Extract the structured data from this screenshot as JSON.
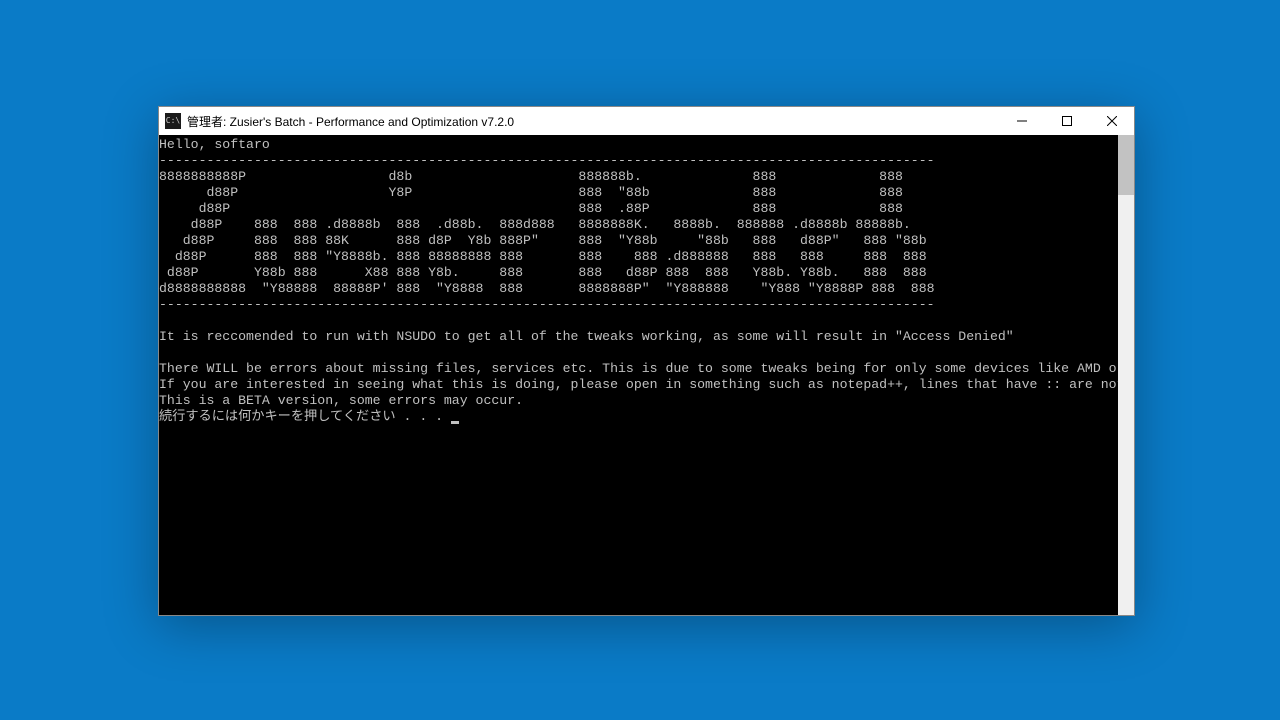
{
  "window": {
    "title": "管理者: Zusier's Batch - Performance and Optimization v7.2.0",
    "icon_label": "C:\\"
  },
  "terminal": {
    "greeting": "Hello, softaro",
    "divider": "--------------------------------------------------------------------------------------------------",
    "ascii_art": [
      "8888888888P                  d8b                     888888b.              888             888",
      "      d88P                   Y8P                     888  \"88b             888             888",
      "     d88P                                            888  .88P             888             888",
      "    d88P    888  888 .d8888b  888  .d88b.  888d888   8888888K.   8888b.  888888 .d8888b 88888b.",
      "   d88P     888  888 88K      888 d8P  Y8b 888P\"     888  \"Y88b     \"88b   888   d88P\"   888 \"88b",
      "  d88P      888  888 \"Y8888b. 888 88888888 888       888    888 .d888888   888   888     888  888",
      " d88P       Y88b 888      X88 888 Y8b.     888       888   d88P 888  888   Y88b. Y88b.   888  888",
      "d8888888888  \"Y88888  88888P' 888  \"Y8888  888       8888888P\"  \"Y888888    \"Y888 \"Y8888P 888  888"
    ],
    "msg_nsudo": "It is reccomended to run with NSUDO to get all of the tweaks working, as some will result in \"Access Denied\"",
    "msg_errors": "There WILL be errors about missing files, services etc. This is due to some tweaks being for only some devices like AMD or NVIDIA",
    "msg_notepad": "If you are interested in seeing what this is doing, please open in something such as notepad++, lines that have :: are notes/documentation",
    "msg_beta": "This is a BETA version, some errors may occur.",
    "msg_continue": "続行するには何かキーを押してください . . . "
  }
}
